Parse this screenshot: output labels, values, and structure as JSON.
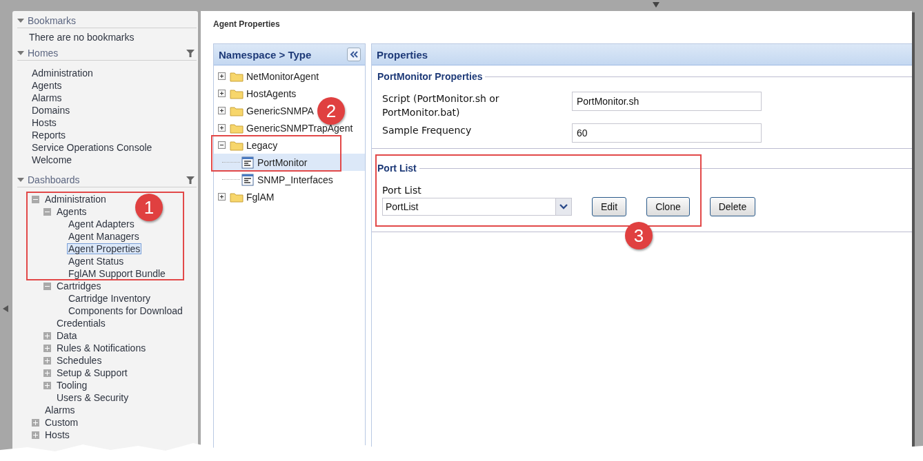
{
  "sidebar": {
    "sections": [
      {
        "title": "Bookmarks",
        "expanded": true,
        "filter": false,
        "empty_text": "There are no bookmarks"
      },
      {
        "title": "Homes",
        "expanded": true,
        "filter": true,
        "items": [
          "Administration",
          "Agents",
          "Alarms",
          "Domains",
          "Hosts",
          "Reports",
          "Service Operations Console",
          "Welcome"
        ]
      },
      {
        "title": "Dashboards",
        "expanded": true,
        "filter": true,
        "tree": [
          {
            "label": "Administration",
            "kind": "group",
            "expanded": true,
            "selected": false,
            "children": [
              {
                "label": "Agents",
                "kind": "group",
                "expanded": true,
                "selected": false,
                "children": [
                  {
                    "label": "Agent Adapters",
                    "kind": "leaf",
                    "selected": false
                  },
                  {
                    "label": "Agent Managers",
                    "kind": "leaf",
                    "selected": false
                  },
                  {
                    "label": "Agent Properties",
                    "kind": "leaf",
                    "selected": true
                  },
                  {
                    "label": "Agent Status",
                    "kind": "leaf",
                    "selected": false
                  },
                  {
                    "label": "FglAM Support Bundle",
                    "kind": "leaf",
                    "selected": false
                  }
                ]
              },
              {
                "label": "Cartridges",
                "kind": "group",
                "expanded": true,
                "selected": false,
                "children": [
                  {
                    "label": "Cartridge Inventory",
                    "kind": "leaf",
                    "selected": false
                  },
                  {
                    "label": "Components for Download",
                    "kind": "leaf",
                    "selected": false
                  }
                ]
              },
              {
                "label": "Credentials",
                "kind": "leaf",
                "selected": false
              },
              {
                "label": "Data",
                "kind": "group",
                "expanded": false,
                "selected": false
              },
              {
                "label": "Rules & Notifications",
                "kind": "group",
                "expanded": false,
                "selected": false
              },
              {
                "label": "Schedules",
                "kind": "group",
                "expanded": false,
                "selected": false
              },
              {
                "label": "Setup & Support",
                "kind": "group",
                "expanded": false,
                "selected": false
              },
              {
                "label": "Tooling",
                "kind": "group",
                "expanded": false,
                "selected": false
              },
              {
                "label": "Users & Security",
                "kind": "leaf",
                "selected": false
              }
            ]
          },
          {
            "label": "Alarms",
            "kind": "leaf",
            "selected": false
          },
          {
            "label": "Custom",
            "kind": "group",
            "expanded": false,
            "selected": false
          },
          {
            "label": "Hosts",
            "kind": "group",
            "expanded": false,
            "selected": false
          }
        ]
      }
    ]
  },
  "page_title": "Agent Properties",
  "namespace_panel": {
    "title": "Namespace > Type",
    "tree": [
      {
        "label": "NetMonitorAgent",
        "kind": "folder",
        "expanded": false,
        "selected": false
      },
      {
        "label": "HostAgents",
        "kind": "folder",
        "expanded": false,
        "selected": false
      },
      {
        "label": "GenericSNMPA",
        "kind": "folder",
        "expanded": false,
        "selected": false
      },
      {
        "label": "GenericSNMPTrapAgent",
        "kind": "folder",
        "expanded": false,
        "selected": false
      },
      {
        "label": "Legacy",
        "kind": "folder",
        "expanded": true,
        "selected": false,
        "children": [
          {
            "label": "PortMonitor",
            "kind": "type",
            "selected": true
          },
          {
            "label": "SNMP_Interfaces",
            "kind": "type",
            "selected": false
          }
        ]
      },
      {
        "label": "FglAM",
        "kind": "folder",
        "expanded": false,
        "selected": false
      }
    ]
  },
  "properties_panel": {
    "title": "Properties",
    "group": {
      "legend": "PortMonitor Properties",
      "fields": [
        {
          "label": "Script (PortMonitor.sh or PortMonitor.bat)",
          "value": "PortMonitor.sh"
        },
        {
          "label": "Sample Frequency",
          "value": "60"
        }
      ]
    },
    "port_list": {
      "legend": "Port List",
      "label": "Port List",
      "value": "PortList",
      "buttons": [
        "Edit",
        "Clone",
        "Delete"
      ]
    }
  },
  "callouts": [
    {
      "number": "1"
    },
    {
      "number": "2"
    },
    {
      "number": "3"
    }
  ]
}
